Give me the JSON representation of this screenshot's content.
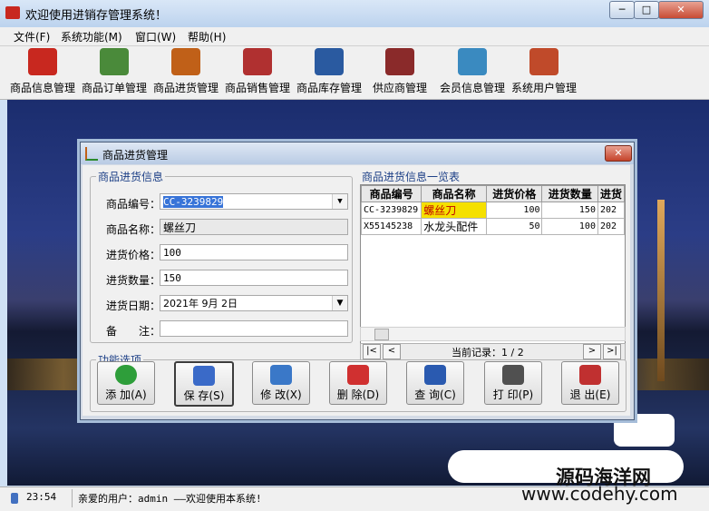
{
  "window": {
    "title": "欢迎使用进销存管理系统！",
    "min": "─",
    "max": "□",
    "close": "✕"
  },
  "menu": [
    {
      "label": "文件(F)"
    },
    {
      "label": "系统功能(M)"
    },
    {
      "label": "窗口(W)"
    },
    {
      "label": "帮助(H)"
    }
  ],
  "toolbar": [
    {
      "label": "商品信息管理",
      "icon": "product-info-icon",
      "color": "#c8281f"
    },
    {
      "label": "商品订单管理",
      "icon": "order-icon",
      "color": "#4a8a3a"
    },
    {
      "label": "商品进货管理",
      "icon": "purchase-icon",
      "color": "#c06018"
    },
    {
      "label": "商品销售管理",
      "icon": "sales-icon",
      "color": "#b03030"
    },
    {
      "label": "商品库存管理",
      "icon": "inventory-icon",
      "color": "#2a5aa0"
    },
    {
      "label": "供应商管理",
      "icon": "supplier-icon",
      "color": "#8a2a2a"
    },
    {
      "label": "会员信息管理",
      "icon": "member-icon",
      "color": "#3a8ac0"
    },
    {
      "label": "系统用户管理",
      "icon": "user-icon",
      "color": "#c04a2a"
    }
  ],
  "dialog": {
    "title": "商品进货管理",
    "close": "✕",
    "info_legend": "商品进货信息",
    "list_legend": "商品进货信息一览表",
    "actions_legend": "功能选项",
    "form": {
      "code_label": "商品编号：",
      "code_value": "CC-3239829",
      "name_label": "商品名称：",
      "name_value": "螺丝刀",
      "price_label": "进货价格：",
      "price_value": "100",
      "qty_label": "进货数量：",
      "qty_value": "150",
      "date_label": "进货日期：",
      "date_value": "2021年 9月 2日",
      "note_label": "备　　注：",
      "note_value": ""
    },
    "grid": {
      "columns": [
        "商品编号",
        "商品名称",
        "进货价格",
        "进货数量",
        "进货"
      ],
      "rows": [
        [
          "CC-3239829",
          "螺丝刀",
          "100",
          "150",
          "202"
        ],
        [
          "X55145238",
          "水龙头配件",
          "50",
          "100",
          "202"
        ]
      ]
    },
    "nav": {
      "first": "|<",
      "prev": "<",
      "record_text": "当前记录：1 / 2",
      "next": ">",
      "last": ">|"
    },
    "actions": [
      {
        "label": "添 加(A)",
        "icon": "add-icon",
        "color": "#2e9e3a"
      },
      {
        "label": "保 存(S)",
        "icon": "save-icon",
        "color": "#3a6ac8"
      },
      {
        "label": "修 改(X)",
        "icon": "edit-icon",
        "color": "#3a78c8"
      },
      {
        "label": "删 除(D)",
        "icon": "delete-icon",
        "color": "#d03030"
      },
      {
        "label": "查 询(C)",
        "icon": "query-icon",
        "color": "#2a5ab0"
      },
      {
        "label": "打 印(P)",
        "icon": "print-icon",
        "color": "#505050"
      },
      {
        "label": "退 出(E)",
        "icon": "exit-icon",
        "color": "#c03030"
      }
    ]
  },
  "status": {
    "time": "23:54",
    "message": "亲爱的用户：admin ——欢迎使用本系统!"
  },
  "watermark": {
    "line1": "源码海洋网",
    "line2": "www.codehy.com"
  }
}
